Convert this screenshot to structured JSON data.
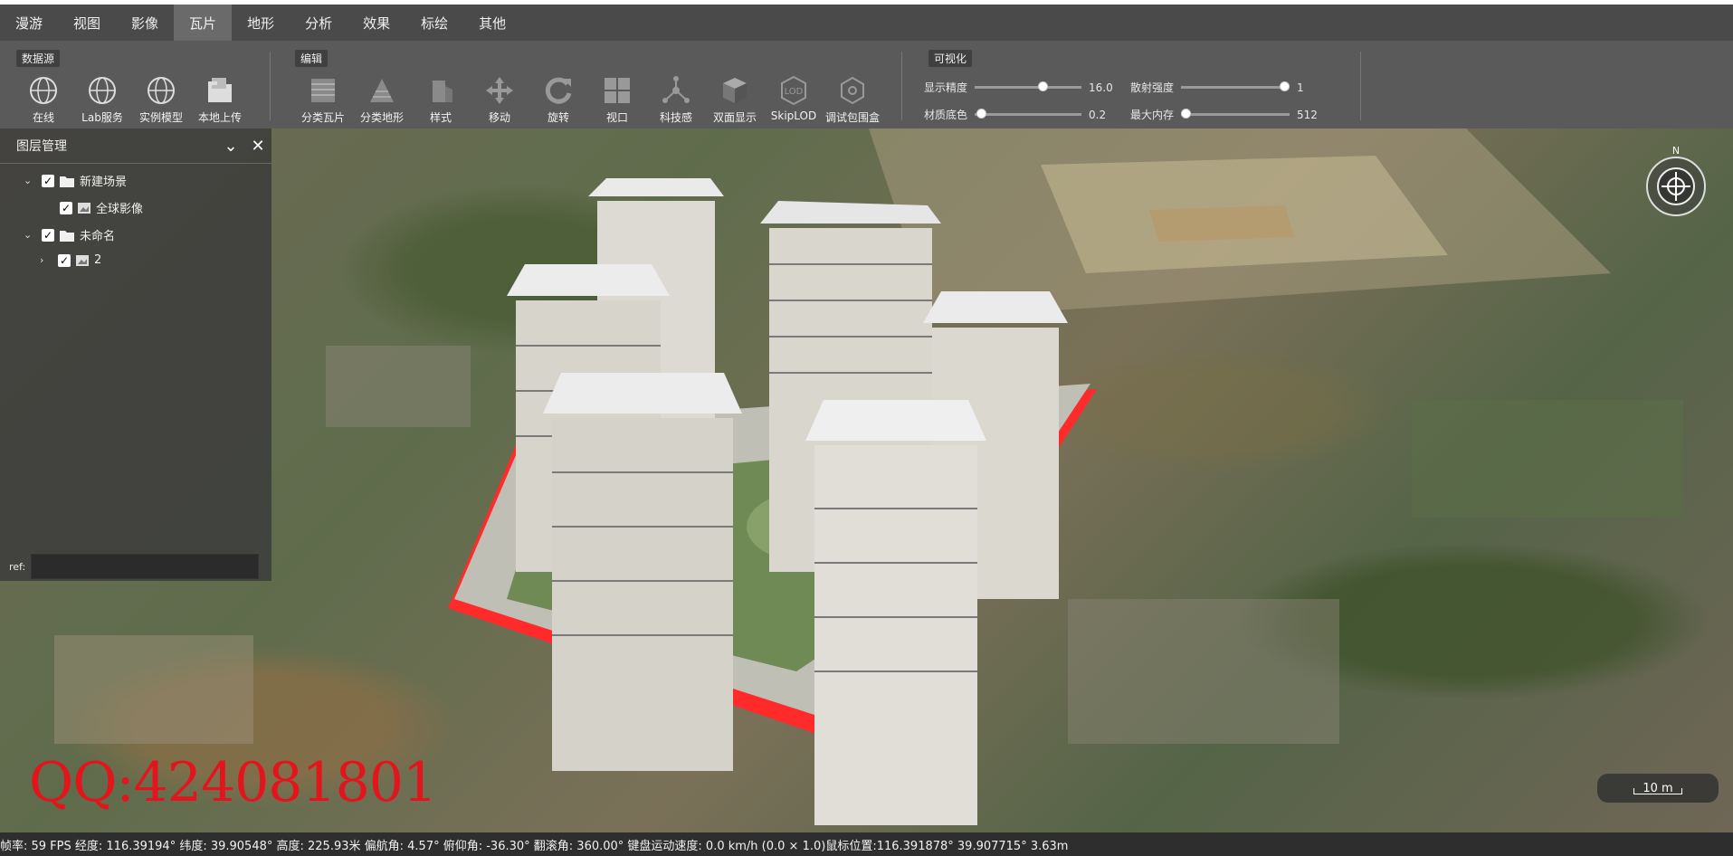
{
  "menu": [
    "漫游",
    "视图",
    "影像",
    "瓦片",
    "地形",
    "分析",
    "效果",
    "标绘",
    "其他"
  ],
  "ribbon": {
    "datasource_label": "数据源",
    "datasource_tools": [
      "在线",
      "Lab服务",
      "实例模型",
      "本地上传"
    ],
    "edit_label": "编辑",
    "edit_tools": [
      "分类瓦片",
      "分类地形",
      "样式",
      "移动",
      "旋转",
      "视口",
      "科技感",
      "双面显示",
      "SkipLOD",
      "调试包围盒"
    ],
    "visual_label": "可视化",
    "sliders": [
      {
        "label": "显示精度",
        "value": "16.0",
        "fraction": 0.65
      },
      {
        "label": "散射强度",
        "value": "1",
        "fraction": 1.0
      },
      {
        "label": "材质底色",
        "value": "0.2",
        "fraction": 0.02
      },
      {
        "label": "最大内存",
        "value": "512",
        "fraction": 0.0
      }
    ]
  },
  "layer_panel": {
    "title": "图层管理",
    "tree": [
      {
        "label": "新建场景"
      },
      {
        "label": "全球影像"
      },
      {
        "label": "未命名"
      },
      {
        "label": "2"
      }
    ],
    "ref_label": "ref:"
  },
  "compass": {
    "north": "N"
  },
  "scale": "10 m",
  "watermark": "QQ:424081801",
  "status": "帧率: 59 FPS 经度: 116.39194° 纬度: 39.90548° 高度: 225.93米 偏航角: 4.57° 俯仰角: -36.30° 翻滚角: 360.00° 键盘运动速度: 0.0 km/h (0.0 × 1.0)鼠标位置:116.391878° 39.907715° 3.63m",
  "colors": {
    "highlight_outline": "#ff2a2a",
    "watermark": "#e3141c"
  }
}
